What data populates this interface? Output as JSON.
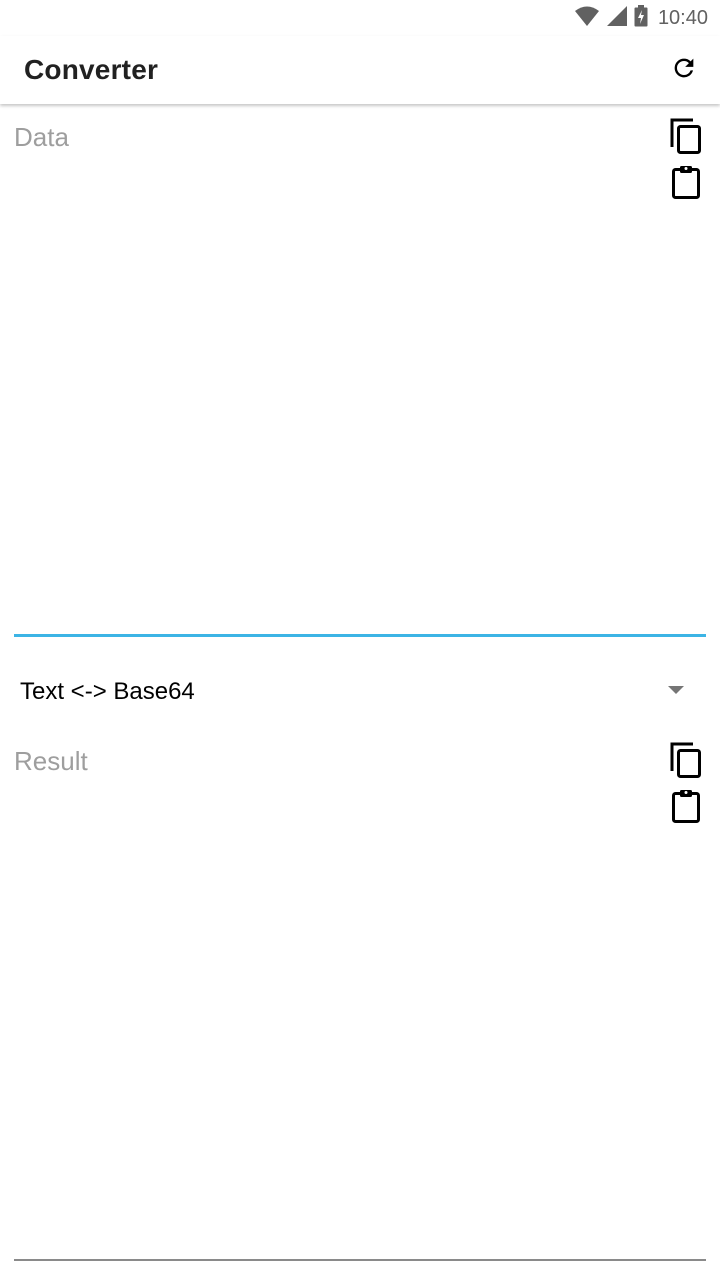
{
  "status_bar": {
    "time": "10:40",
    "icons": [
      "wifi-icon",
      "cell-signal-icon",
      "battery-charging-icon"
    ]
  },
  "app_bar": {
    "title": "Converter",
    "actions": [
      "refresh-icon"
    ]
  },
  "data_field": {
    "placeholder": "Data",
    "value": "",
    "actions": [
      "copy-icon",
      "paste-icon"
    ]
  },
  "conversion_select": {
    "selected": "Text <-> Base64",
    "icon": "dropdown-arrow-icon"
  },
  "result_field": {
    "placeholder": "Result",
    "value": "",
    "actions": [
      "copy-icon",
      "paste-icon"
    ]
  },
  "colors": {
    "accent": "#3cb4e5",
    "text": "#212121",
    "hint": "#9e9e9e",
    "icon": "#000000",
    "status_icon": "#616161"
  }
}
